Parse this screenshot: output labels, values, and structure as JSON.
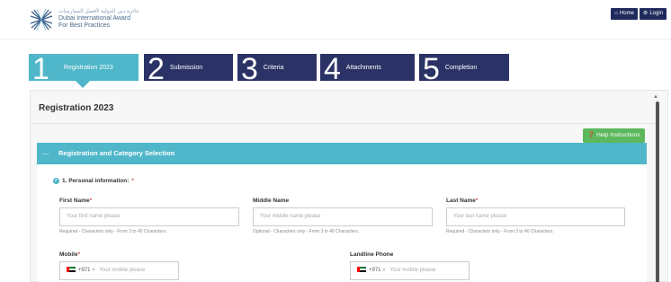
{
  "header": {
    "logo_arabic": "جائزة دبي الدولية لأفضل الممارسات",
    "logo_line1": "Dubai International Award",
    "logo_line2": "For Best Practices",
    "home_label": "Home",
    "login_label": "Login"
  },
  "steps": [
    {
      "num": "1",
      "label": "Registration 2023",
      "active": true
    },
    {
      "num": "2",
      "label": "Submission"
    },
    {
      "num": "3",
      "label": "Criteria"
    },
    {
      "num": "4",
      "label": "Attachments"
    },
    {
      "num": "5",
      "label": "Completion"
    }
  ],
  "panel": {
    "title": "Registration 2023",
    "help_label": "Help Instructions",
    "section_title": "Registration and Category Selection"
  },
  "form": {
    "personal_info_label": "1. Personal information:",
    "first_name": {
      "label": "First Name",
      "placeholder": "Your first name please",
      "hint": "Required - Characters only - From 3 to 40 Characters."
    },
    "middle_name": {
      "label": "Middle Name",
      "placeholder": "Your middle name please",
      "hint": "Optional - Characters only - From 3 to 40 Characters."
    },
    "last_name": {
      "label": "Last Name",
      "placeholder": "Your last name please",
      "hint": "Required - Characters only - From 3 to 40 Characters."
    },
    "mobile": {
      "label": "Mobile",
      "country_code": "+971",
      "placeholder": "Your mobile please"
    },
    "landline": {
      "label": "Landline Phone",
      "country_code": "+971",
      "placeholder": "Your mobile please"
    }
  },
  "colors": {
    "accent": "#4fb7c9",
    "navy": "#2b3366",
    "help_green": "#5cb85c"
  }
}
